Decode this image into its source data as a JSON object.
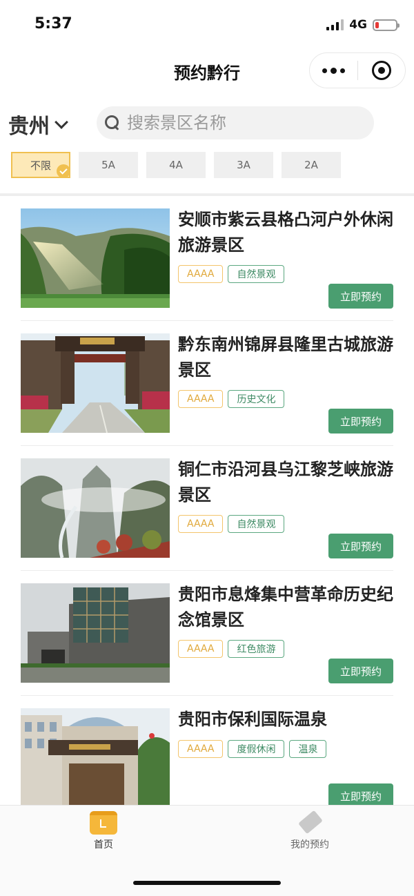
{
  "status_bar": {
    "time": "5:37",
    "network": "4G"
  },
  "nav": {
    "title": "预约黔行"
  },
  "search": {
    "city": "贵州",
    "placeholder": "搜索景区名称"
  },
  "filters": [
    {
      "label": "不限",
      "selected": true
    },
    {
      "label": "5A",
      "selected": false
    },
    {
      "label": "4A",
      "selected": false
    },
    {
      "label": "3A",
      "selected": false
    },
    {
      "label": "2A",
      "selected": false
    }
  ],
  "list": {
    "book_label": "立即预约",
    "items": [
      {
        "title": "安顺市紫云县格凸河户外休闲旅游景区",
        "level": "AAAA",
        "types": [
          "自然景观"
        ],
        "image": "canyon-waterfall-photo"
      },
      {
        "title": "黔东南州锦屏县隆里古城旅游景区",
        "level": "AAAA",
        "types": [
          "历史文化"
        ],
        "image": "ancient-town-gate-photo"
      },
      {
        "title": "铜仁市沿河县乌江黎芝峡旅游景区",
        "level": "AAAA",
        "types": [
          "自然景观"
        ],
        "image": "river-gorge-photo"
      },
      {
        "title": "贵阳市息烽集中营革命历史纪念馆景区",
        "level": "AAAA",
        "types": [
          "红色旅游"
        ],
        "image": "memorial-hall-photo"
      },
      {
        "title": "贵阳市保利国际温泉",
        "level": "AAAA",
        "types": [
          "度假休闲",
          "温泉"
        ],
        "image": "hot-spring-hotel-photo"
      }
    ]
  },
  "tab_bar": {
    "home": "首页",
    "mine": "我的预约"
  },
  "colors": {
    "accent_green": "#4a9e70",
    "level_gold": "#f3c46a",
    "selected_filter": "#fde9b8"
  }
}
